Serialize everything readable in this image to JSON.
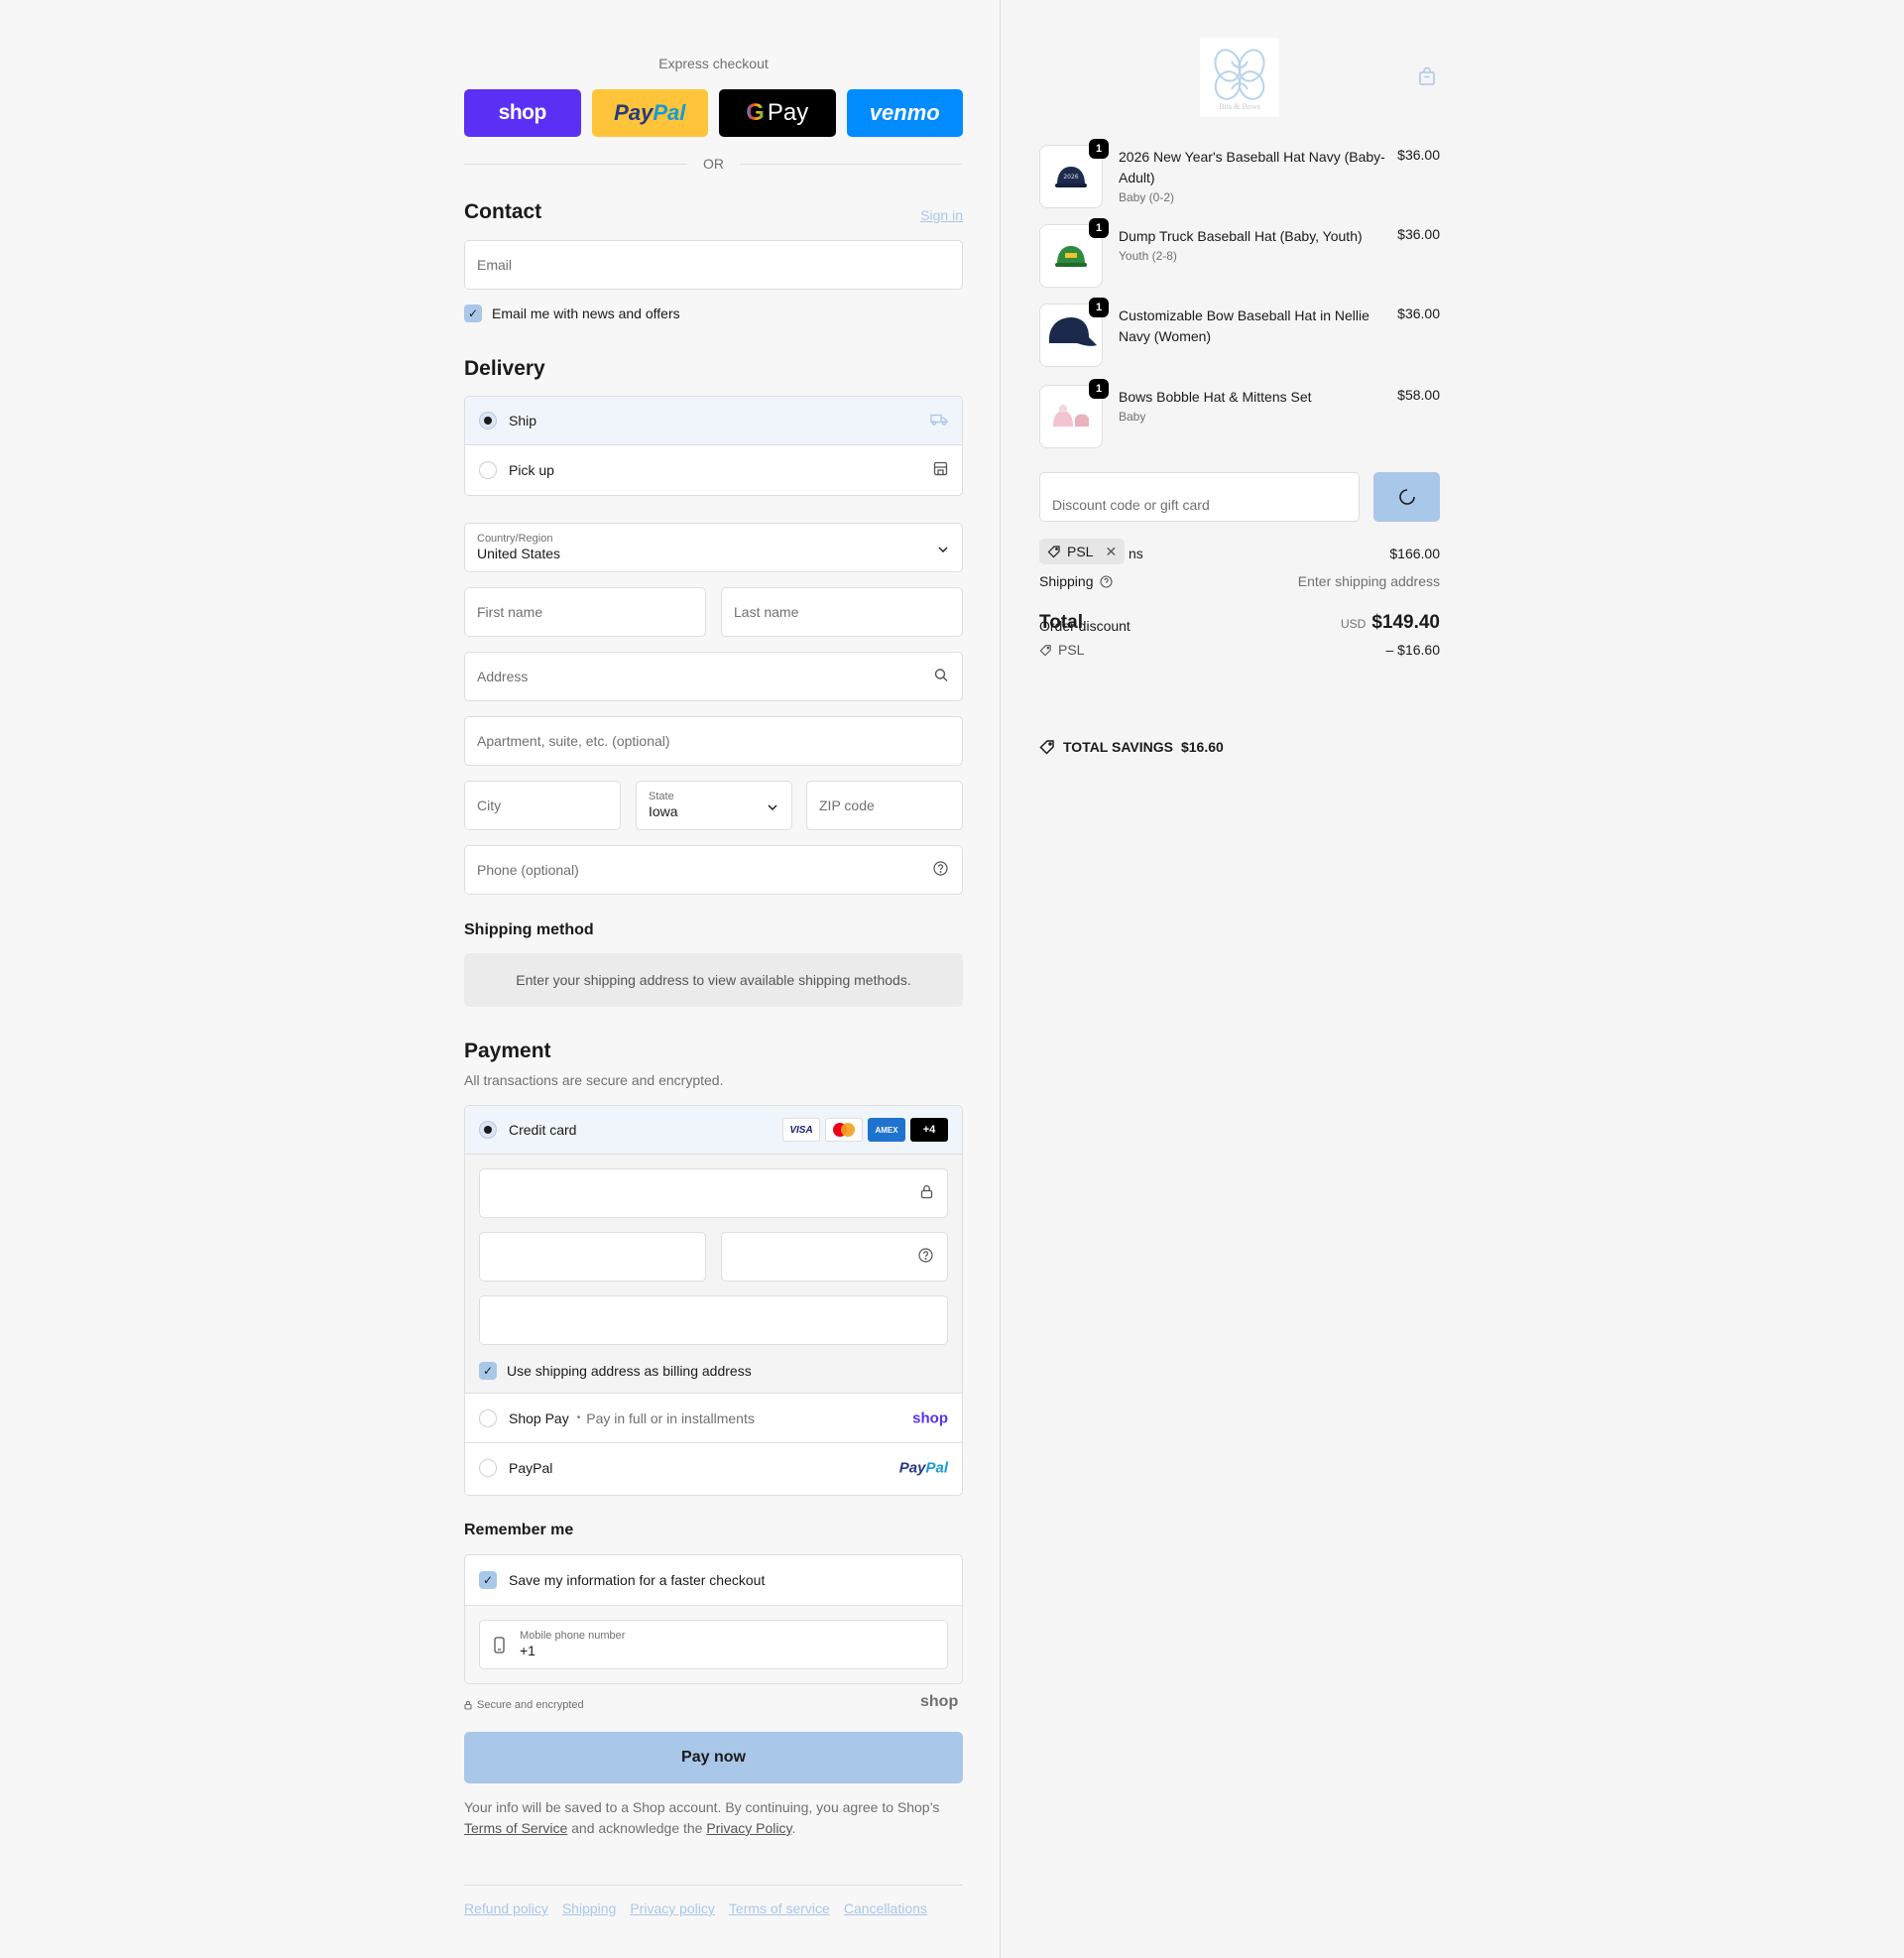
{
  "express": {
    "title": "Express checkout",
    "shop": "shop",
    "paypal_a": "Pay",
    "paypal_b": "Pal",
    "gpay_g": "G",
    "gpay": "Pay",
    "venmo": "venmo",
    "or": "OR"
  },
  "contact": {
    "heading": "Contact",
    "sign_in": "Sign in",
    "email_placeholder": "Email",
    "news_label": "Email me with news and offers"
  },
  "delivery": {
    "heading": "Delivery",
    "options": [
      {
        "label": "Ship",
        "selected": true
      },
      {
        "label": "Pick up",
        "selected": false
      }
    ],
    "country_label": "Country/Region",
    "country_value": "United States",
    "first_name": "First name",
    "last_name": "Last name",
    "address": "Address",
    "apartment": "Apartment, suite, etc. (optional)",
    "city": "City",
    "state_label": "State",
    "state_value": "Iowa",
    "zip": "ZIP code",
    "phone": "Phone (optional)"
  },
  "shipping_method": {
    "heading": "Shipping method",
    "info": "Enter your shipping address to view available shipping methods."
  },
  "payment": {
    "heading": "Payment",
    "subtitle": "All transactions are secure and encrypted.",
    "credit_card": "Credit card",
    "cards": {
      "visa": "VISA",
      "amex": "AMEX",
      "more": "+4"
    },
    "billing_label": "Use shipping address as billing address",
    "shop_pay": "Shop Pay",
    "shop_pay_sep": "•",
    "shop_pay_note": "Pay in full or in installments",
    "shop_pay_logo": "shop",
    "paypal": "PayPal",
    "paypal_logo_a": "Pay",
    "paypal_logo_b": "Pal"
  },
  "remember": {
    "heading": "Remember me",
    "save_label": "Save my information for a faster checkout",
    "mobile_label": "Mobile phone number",
    "mobile_value": "+1",
    "secure": "Secure and encrypted",
    "shop_logo": "shop"
  },
  "pay_now": "Pay now",
  "legal": {
    "text1": "Your info will be saved to a Shop account. By continuing, you agree to Shop’s",
    "terms": "Terms of Service",
    "text2": "and acknowledge the",
    "privacy": "Privacy Policy",
    "text3": "."
  },
  "footer": [
    "Refund policy",
    "Shipping",
    "Privacy policy",
    "Terms of service",
    "Cancellations"
  ],
  "brand": {
    "logo_text": "Bits & Bows"
  },
  "cart": {
    "items": [
      {
        "qty": "1",
        "name": "2026 New Year's Baseball Hat Navy (Baby-Adult)",
        "variant": "Baby (0-2)",
        "price": "$36.00",
        "color": "#1c2b4f"
      },
      {
        "qty": "1",
        "name": "Dump Truck Baseball Hat (Baby, Youth)",
        "variant": "Youth (2-8)",
        "price": "$36.00",
        "color": "#2e8b3d"
      },
      {
        "qty": "1",
        "name": "Customizable Bow Baseball Hat in Nellie Navy (Women)",
        "variant": "",
        "price": "$36.00",
        "color": "#1b2a4a"
      },
      {
        "qty": "1",
        "name": "Bows Bobble Hat & Mittens Set",
        "variant": "Baby",
        "price": "$58.00",
        "color": "#f2c4cf"
      }
    ],
    "discount_placeholder": "Discount code or gift card",
    "applied_code": "PSL",
    "subtotal_label_tail": "ns",
    "subtotal": "$166.00",
    "shipping_label": "Shipping",
    "shipping_value": "Enter shipping address",
    "total_label": "Total",
    "order_discount_label": "Order discount",
    "currency": "USD",
    "total": "$149.40",
    "discount_code": "PSL",
    "discount_value": "– $16.60",
    "savings_label": "TOTAL SAVINGS",
    "savings_value": "$16.60"
  },
  "colors": {
    "accent": "#a9c7e8",
    "shop": "#5a31f4",
    "paypal": "#ffc439",
    "venmo": "#008cff"
  }
}
